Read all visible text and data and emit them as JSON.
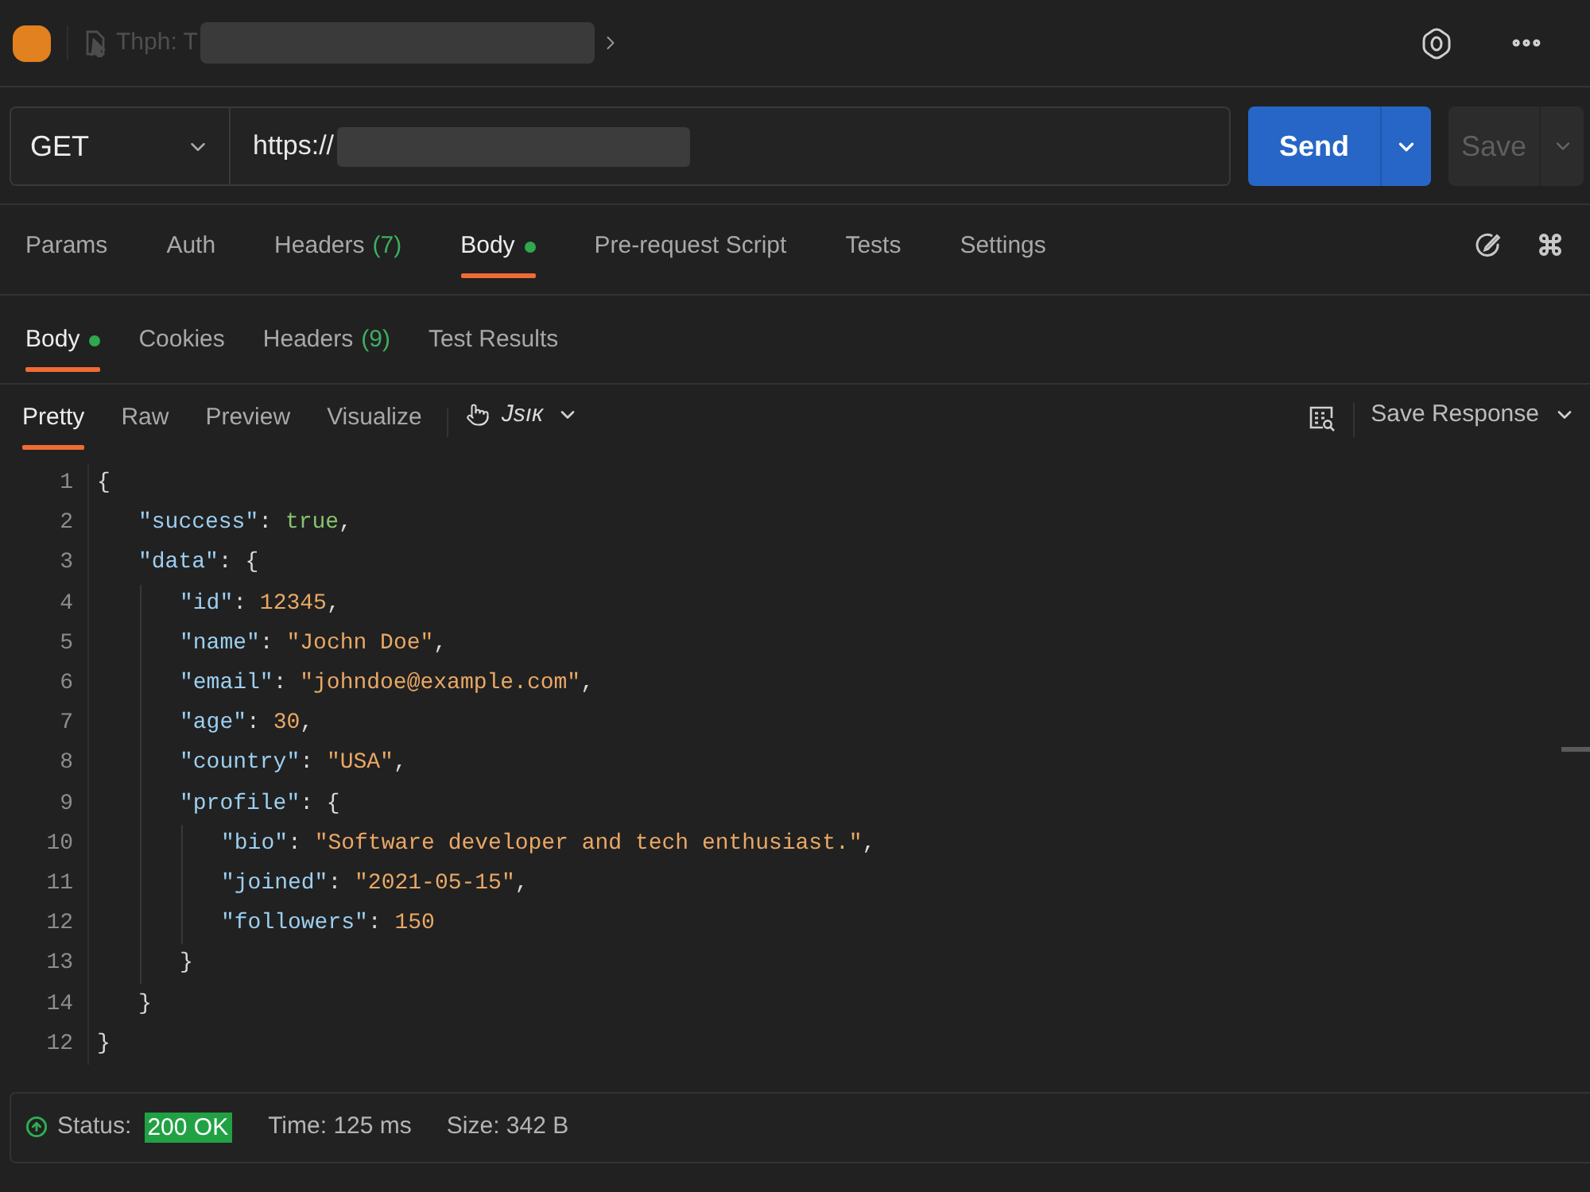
{
  "top_bar": {
    "tab_title": "Thph: T"
  },
  "request": {
    "method": "GET",
    "url": "https://",
    "send_button": "Send",
    "save_button": {
      "label": "Save",
      "disabled": true
    }
  },
  "request_tabs": [
    {
      "label": "Params",
      "selected": false,
      "indicator": false
    },
    {
      "label": "Auth",
      "selected": false,
      "indicator": false
    },
    {
      "label": "Headers",
      "count": "(7)",
      "selected": false,
      "indicator": false
    },
    {
      "label": "Body",
      "selected": true,
      "indicator": true
    },
    {
      "label": "Pre-request Script",
      "selected": false,
      "indicator": false
    },
    {
      "label": "Tests",
      "selected": false,
      "indicator": false
    },
    {
      "label": "Settings",
      "selected": false,
      "indicator": false
    }
  ],
  "response_tabs": [
    {
      "label": "Body",
      "selected": true,
      "indicator": true
    },
    {
      "label": "Cookies",
      "selected": false,
      "indicator": false
    },
    {
      "label": "Headers",
      "count": "(9)",
      "selected": false,
      "indicator": false
    },
    {
      "label": "Test Results",
      "selected": false,
      "indicator": false
    }
  ],
  "view_tabs": [
    {
      "label": "Pretty",
      "selected": true
    },
    {
      "label": "Raw",
      "selected": false
    },
    {
      "label": "Preview",
      "selected": false
    },
    {
      "label": "Visualize",
      "selected": false
    }
  ],
  "language": "Jsıк",
  "save_response": "Save Response",
  "code": {
    "lines": [
      {
        "number": "1",
        "tokens": [
          {
            "kind": "punct",
            "text": "{"
          }
        ],
        "children": [
          {
            "number": "2",
            "tokens": [
              {
                "kind": "key",
                "text": "\"success\""
              },
              {
                "kind": "punct",
                "text": ": "
              },
              {
                "kind": "boolean",
                "text": "true"
              },
              {
                "kind": "punct",
                "text": ","
              }
            ]
          },
          {
            "number": "3",
            "tokens": [
              {
                "kind": "key",
                "text": "\"data\""
              },
              {
                "kind": "punct",
                "text": ": {"
              }
            ],
            "children": [
              {
                "number": "4",
                "tokens": [
                  {
                    "kind": "key",
                    "text": "\"id\""
                  },
                  {
                    "kind": "punct",
                    "text": ": "
                  },
                  {
                    "kind": "number",
                    "text": "12345"
                  },
                  {
                    "kind": "punct",
                    "text": ","
                  }
                ]
              },
              {
                "number": "5",
                "tokens": [
                  {
                    "kind": "key",
                    "text": "\"name\""
                  },
                  {
                    "kind": "punct",
                    "text": ": "
                  },
                  {
                    "kind": "string",
                    "text": "\"Jochn Doe\""
                  },
                  {
                    "kind": "punct",
                    "text": ","
                  }
                ]
              },
              {
                "number": "6",
                "tokens": [
                  {
                    "kind": "key",
                    "text": "\"email\""
                  },
                  {
                    "kind": "punct",
                    "text": ": "
                  },
                  {
                    "kind": "string",
                    "text": "\"johndoe@example.com\""
                  },
                  {
                    "kind": "punct",
                    "text": ","
                  }
                ]
              },
              {
                "number": "7",
                "tokens": [
                  {
                    "kind": "key",
                    "text": "\"age\""
                  },
                  {
                    "kind": "punct",
                    "text": ": "
                  },
                  {
                    "kind": "number",
                    "text": "30"
                  },
                  {
                    "kind": "punct",
                    "text": ","
                  }
                ]
              },
              {
                "number": "8",
                "tokens": [
                  {
                    "kind": "key",
                    "text": "\"country\""
                  },
                  {
                    "kind": "punct",
                    "text": ": "
                  },
                  {
                    "kind": "string",
                    "text": "\"USA\""
                  },
                  {
                    "kind": "punct",
                    "text": ","
                  }
                ]
              },
              {
                "number": "9",
                "tokens": [
                  {
                    "kind": "key",
                    "text": "\"profile\""
                  },
                  {
                    "kind": "punct",
                    "text": ": {"
                  }
                ],
                "children": [
                  {
                    "number": "10",
                    "tokens": [
                      {
                        "kind": "key",
                        "text": "\"bio\""
                      },
                      {
                        "kind": "punct",
                        "text": ": "
                      },
                      {
                        "kind": "string",
                        "text": "\"Software developer and tech enthusiast.\""
                      },
                      {
                        "kind": "punct",
                        "text": ","
                      }
                    ]
                  },
                  {
                    "number": "11",
                    "tokens": [
                      {
                        "kind": "key",
                        "text": "\"joined\""
                      },
                      {
                        "kind": "punct",
                        "text": ": "
                      },
                      {
                        "kind": "string",
                        "text": "\"2021-05-15\""
                      },
                      {
                        "kind": "punct",
                        "text": ","
                      }
                    ]
                  },
                  {
                    "number": "12",
                    "tokens": [
                      {
                        "kind": "key",
                        "text": "\"followers\""
                      },
                      {
                        "kind": "punct",
                        "text": ": "
                      },
                      {
                        "kind": "number",
                        "text": "150"
                      }
                    ]
                  }
                ]
              },
              {
                "number": "13",
                "tokens": [
                  {
                    "kind": "punct",
                    "text": "}"
                  }
                ]
              }
            ]
          },
          {
            "number": "14",
            "tokens": [
              {
                "kind": "punct",
                "text": "}"
              }
            ]
          }
        ]
      },
      {
        "number": "12",
        "tokens": [
          {
            "kind": "punct",
            "text": "}"
          }
        ]
      }
    ]
  },
  "status_bar": {
    "label": "Status:",
    "code": "200 OK",
    "time": "Time: 125 ms",
    "size": "Size: 342 B"
  }
}
